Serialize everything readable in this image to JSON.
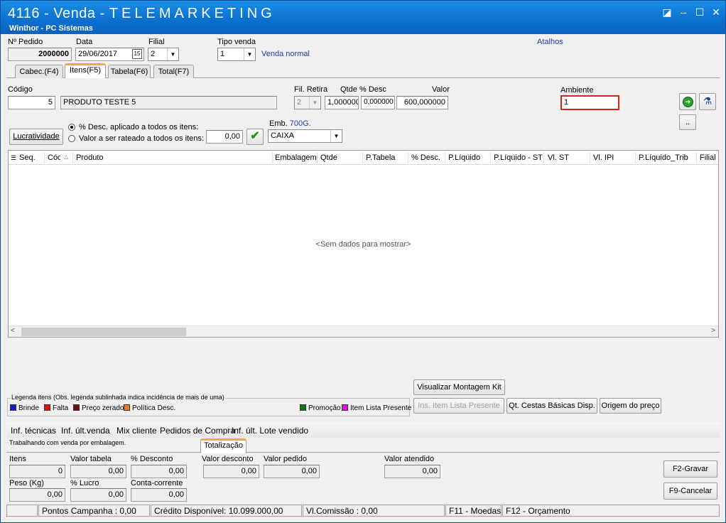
{
  "window": {
    "title_prefix": "4116 - Venda - ",
    "title_main": "TELEMARKETING",
    "subtitle": "Winthor - PC Sistemas"
  },
  "header": {
    "pedido_label": "Nº Pedido",
    "pedido_value": "2000000",
    "data_label": "Data",
    "data_value": "29/06/2017",
    "filial_label": "Filial",
    "filial_value": "2",
    "tipo_venda_label": "Tipo venda",
    "tipo_venda_value": "1",
    "tipo_venda_desc": "Venda normal",
    "atalhos": "Atalhos"
  },
  "tabs": [
    "Cabec.(F4)",
    "Itens(F5)",
    "Tabela(F6)",
    "Total(F7)"
  ],
  "item_form": {
    "codigo_label": "Código",
    "codigo_value": "5",
    "produto_desc": "PRODUTO TESTE 5",
    "fil_retira_label": "Fil. Retira",
    "fil_retira_value": "2",
    "qtde_label": "Qtde",
    "qtde_value": "1,000000",
    "pct_desc_label": "% Desc",
    "pct_desc_value": "0,000000",
    "valor_label": "Valor",
    "valor_value": "600,000000",
    "ambiente_label": "Ambiente",
    "ambiente_value": "1",
    "lucratividade_btn": "Lucratividade",
    "radio1": "% Desc. aplicado a todos os itens:",
    "radio2": "Valor a ser rateado a todos os itens:",
    "rateio_value": "0,00",
    "emb_label": "Emb.",
    "emb_weight": "700G.",
    "emb_value": "CAIXA",
    "dots_btn": ".."
  },
  "grid": {
    "columns": [
      "Seq.",
      "Cód",
      "Produto",
      "Embalagem",
      "Qtde",
      "P.Tabela",
      "% Desc.",
      "P.Líquido",
      "P.Líquido - ST",
      "Vl. ST",
      "Vl. IPI",
      "P.Líquido_Trib",
      "Filial R"
    ],
    "empty_text": "<Sem dados para mostrar>"
  },
  "legend": {
    "title": "Legenda itens (Obs. legenda sublinhada indica incidência de mais de uma)",
    "items": [
      {
        "label": "Brinde",
        "color": "#1a1acc"
      },
      {
        "label": "Falta",
        "color": "#e81010"
      },
      {
        "label": "Preço zerado",
        "color": "#7a0a0a"
      },
      {
        "label": "Política Desc.",
        "color": "#f07a1a"
      },
      {
        "label": "Promoção",
        "color": "#0a7a0a"
      },
      {
        "label": "Item Lista Presente",
        "color": "#e010e0"
      }
    ]
  },
  "buttons": {
    "visualizar": "Visualizar Montagem Kit",
    "ins_item": "Ins. Item Lista Presente",
    "cestas": "Qt. Cestas Básicas Disp.",
    "origem": "Origem do preço",
    "gravar": "F2-Gravar",
    "cancelar": "F9-Cancelar"
  },
  "info_links": [
    "Inf. técnicas",
    "Inf. últ.venda",
    "Mix cliente",
    "Pedidos de Compra",
    "Inf. últ. Lote vendido"
  ],
  "embalagem_msg": "Trabalhando com venda por embalagem.",
  "totals": {
    "tab_label": "Totalização",
    "itens_label": "Itens",
    "itens_value": "0",
    "valor_tabela_label": "Valor tabela",
    "valor_tabela_value": "0,00",
    "pct_desconto_label": "% Desconto",
    "pct_desconto_value": "0,00",
    "valor_desconto_label": "Valor desconto",
    "valor_desconto_value": "0,00",
    "valor_pedido_label": "Valor pedido",
    "valor_pedido_value": "0,00",
    "valor_atendido_label": "Valor atendido",
    "valor_atendido_value": "0,00",
    "peso_label": "Peso (Kg)",
    "peso_value": "0,00",
    "pct_lucro_label": "% Lucro",
    "pct_lucro_value": "0,00",
    "conta_corrente_label": "Conta-corrente",
    "conta_corrente_value": "0,00"
  },
  "statusbar": {
    "pontos": "Pontos Campanha : 0,00",
    "credito": "Crédito Disponível: 10.099.000,00",
    "comissao": "Vl.Comissão : 0,00",
    "moedas": "F11 - Moedas",
    "orcamento": "F12 - Orçamento"
  }
}
